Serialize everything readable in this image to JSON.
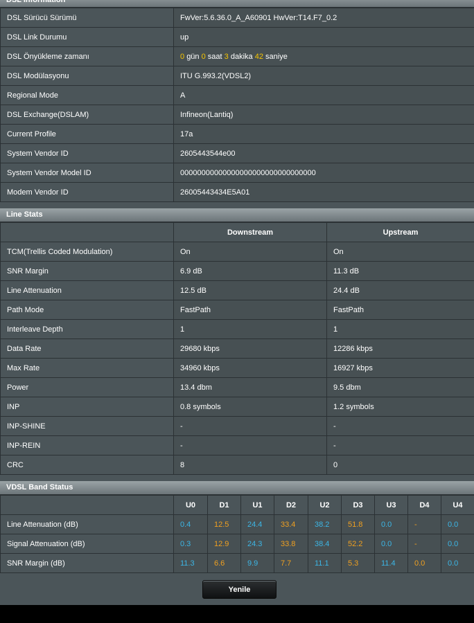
{
  "dsl_info": {
    "title": "DSL Information",
    "rows": [
      {
        "label": "DSL Sürücü Sürümü",
        "value": "FwVer:5.6.36.0_A_A60901 HwVer:T14.F7_0.2"
      },
      {
        "label": "DSL Link Durumu",
        "value": "up"
      },
      {
        "label": "DSL Önyükleme zamanı",
        "uptime": {
          "days": "0",
          "days_unit": "gün",
          "hours": "0",
          "hours_unit": "saat",
          "minutes": "3",
          "minutes_unit": "dakika",
          "seconds": "42",
          "seconds_unit": "saniye"
        }
      },
      {
        "label": "DSL Modülasyonu",
        "value": "ITU G.993.2(VDSL2)"
      },
      {
        "label": "Regional Mode",
        "value": "A"
      },
      {
        "label": "DSL Exchange(DSLAM)",
        "value": "Infineon(Lantiq)"
      },
      {
        "label": "Current Profile",
        "value": "17a"
      },
      {
        "label": "System Vendor ID",
        "value": "2605443544e00"
      },
      {
        "label": "System Vendor Model ID",
        "value": "00000000000000000000000000000000"
      },
      {
        "label": "Modem Vendor ID",
        "value": "26005443434E5A01"
      }
    ]
  },
  "line_stats": {
    "title": "Line Stats",
    "headers": [
      "Downstream",
      "Upstream"
    ],
    "rows": [
      {
        "label": "TCM(Trellis Coded Modulation)",
        "down": "On",
        "up": "On"
      },
      {
        "label": "SNR Margin",
        "down": "6.9 dB",
        "up": "11.3 dB"
      },
      {
        "label": "Line Attenuation",
        "down": "12.5 dB",
        "up": "24.4 dB"
      },
      {
        "label": "Path Mode",
        "down": "FastPath",
        "up": "FastPath"
      },
      {
        "label": "Interleave Depth",
        "down": "1",
        "up": "1"
      },
      {
        "label": "Data Rate",
        "down": "29680 kbps",
        "up": "12286 kbps"
      },
      {
        "label": "Max Rate",
        "down": "34960 kbps",
        "up": "16927 kbps"
      },
      {
        "label": "Power",
        "down": "13.4 dbm",
        "up": "9.5 dbm"
      },
      {
        "label": "INP",
        "down": "0.8 symbols",
        "up": "1.2 symbols"
      },
      {
        "label": "INP-SHINE",
        "down": "-",
        "up": "-"
      },
      {
        "label": "INP-REIN",
        "down": "-",
        "up": "-"
      },
      {
        "label": "CRC",
        "down": "8",
        "up": "0"
      }
    ]
  },
  "band_status": {
    "title": "VDSL Band Status",
    "bands": [
      "U0",
      "D1",
      "U1",
      "D2",
      "U2",
      "D3",
      "U3",
      "D4",
      "U4"
    ],
    "rows": [
      {
        "label": "Line Attenuation (dB)",
        "values": [
          "0.4",
          "12.5",
          "24.4",
          "33.4",
          "38.2",
          "51.8",
          "0.0",
          "-",
          "0.0"
        ]
      },
      {
        "label": "Signal Attenuation (dB)",
        "values": [
          "0.3",
          "12.9",
          "24.3",
          "33.8",
          "38.4",
          "52.2",
          "0.0",
          "-",
          "0.0"
        ]
      },
      {
        "label": "SNR Margin (dB)",
        "values": [
          "11.3",
          "6.6",
          "9.9",
          "7.7",
          "11.1",
          "5.3",
          "11.4",
          "0.0",
          "0.0"
        ]
      }
    ]
  },
  "colors": {
    "upstream_value": "#3cb6e6",
    "downstream_value": "#f0a020",
    "highlight": "#f7c500"
  },
  "refresh_button": {
    "label": "Yenile"
  }
}
